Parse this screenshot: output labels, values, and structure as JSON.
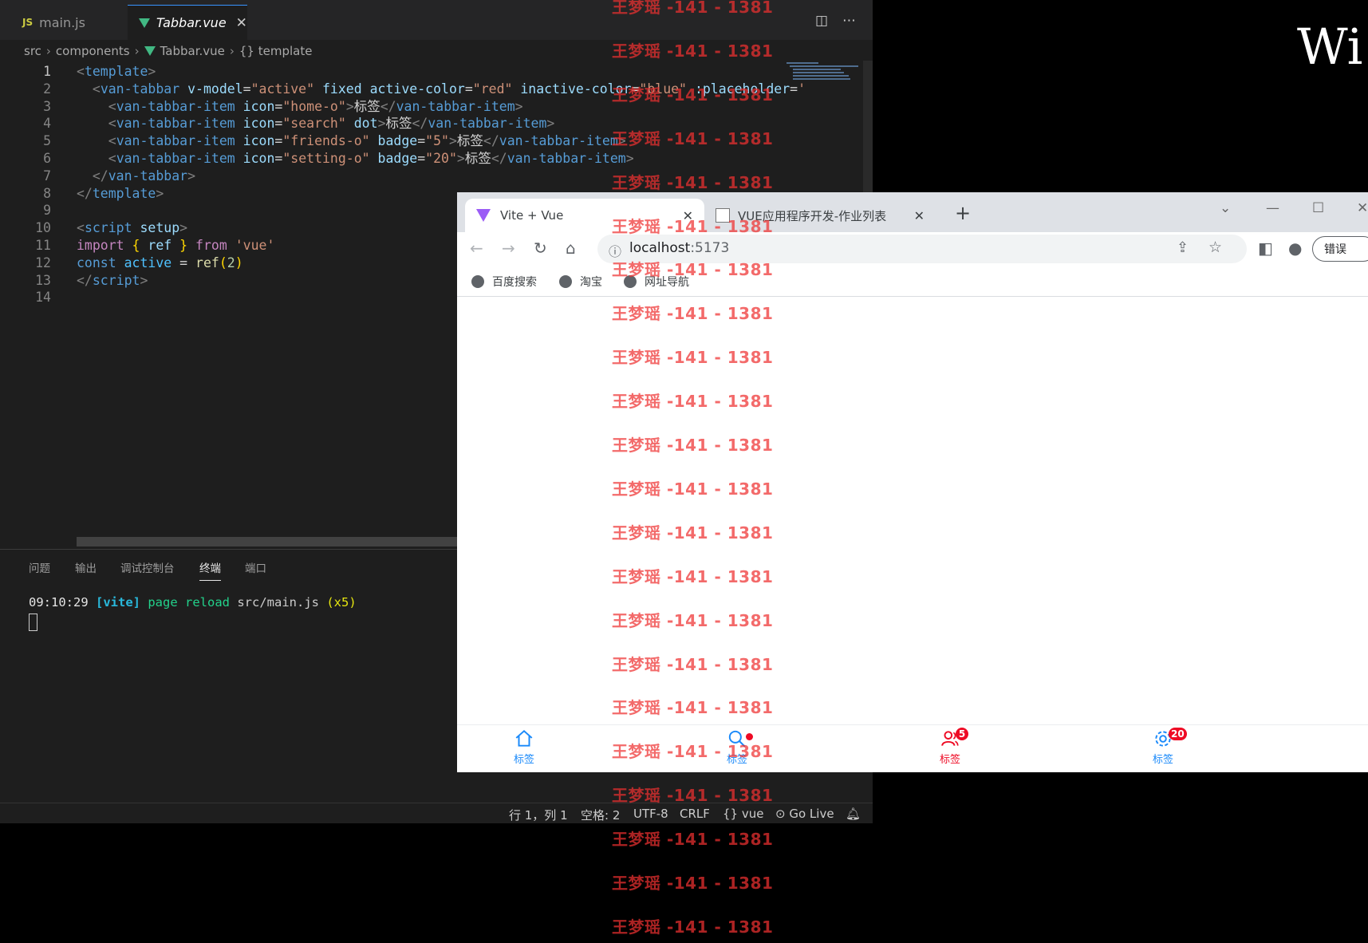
{
  "vscode": {
    "tabs": [
      {
        "badge": "JS",
        "label": "main.js"
      },
      {
        "label": "Tabbar.vue"
      }
    ],
    "breadcrumb": [
      "src",
      "components",
      "Tabbar.vue",
      "{} template"
    ],
    "code_lines": [
      [
        {
          "c": "br",
          "t": "<"
        },
        {
          "c": "t",
          "t": "template"
        },
        {
          "c": "br",
          "t": ">"
        }
      ],
      [
        {
          "c": "w",
          "t": "  "
        },
        {
          "c": "br",
          "t": "<"
        },
        {
          "c": "t",
          "t": "van-tabbar"
        },
        {
          "c": "w",
          "t": " "
        },
        {
          "c": "a",
          "t": "v-model"
        },
        {
          "c": "w",
          "t": "="
        },
        {
          "c": "s",
          "t": "\"active\""
        },
        {
          "c": "w",
          "t": " "
        },
        {
          "c": "a",
          "t": "fixed"
        },
        {
          "c": "w",
          "t": " "
        },
        {
          "c": "a",
          "t": "active-color"
        },
        {
          "c": "w",
          "t": "="
        },
        {
          "c": "s",
          "t": "\"red\""
        },
        {
          "c": "w",
          "t": " "
        },
        {
          "c": "a",
          "t": "inactive-color"
        },
        {
          "c": "w",
          "t": "="
        },
        {
          "c": "s",
          "t": "\"blue\""
        },
        {
          "c": "w",
          "t": " "
        },
        {
          "c": "a",
          "t": ":placeholder"
        },
        {
          "c": "w",
          "t": "="
        },
        {
          "c": "s",
          "t": "'"
        }
      ],
      [
        {
          "c": "w",
          "t": "    "
        },
        {
          "c": "br",
          "t": "<"
        },
        {
          "c": "t",
          "t": "van-tabbar-item"
        },
        {
          "c": "w",
          "t": " "
        },
        {
          "c": "a",
          "t": "icon"
        },
        {
          "c": "w",
          "t": "="
        },
        {
          "c": "s",
          "t": "\"home-o\""
        },
        {
          "c": "br",
          "t": ">"
        },
        {
          "c": "w",
          "t": "标签"
        },
        {
          "c": "br",
          "t": "</"
        },
        {
          "c": "t",
          "t": "van-tabbar-item"
        },
        {
          "c": "br",
          "t": ">"
        }
      ],
      [
        {
          "c": "w",
          "t": "    "
        },
        {
          "c": "br",
          "t": "<"
        },
        {
          "c": "t",
          "t": "van-tabbar-item"
        },
        {
          "c": "w",
          "t": " "
        },
        {
          "c": "a",
          "t": "icon"
        },
        {
          "c": "w",
          "t": "="
        },
        {
          "c": "s",
          "t": "\"search\""
        },
        {
          "c": "w",
          "t": " "
        },
        {
          "c": "a",
          "t": "dot"
        },
        {
          "c": "br",
          "t": ">"
        },
        {
          "c": "w",
          "t": "标签"
        },
        {
          "c": "br",
          "t": "</"
        },
        {
          "c": "t",
          "t": "van-tabbar-item"
        },
        {
          "c": "br",
          "t": ">"
        }
      ],
      [
        {
          "c": "w",
          "t": "    "
        },
        {
          "c": "br",
          "t": "<"
        },
        {
          "c": "t",
          "t": "van-tabbar-item"
        },
        {
          "c": "w",
          "t": " "
        },
        {
          "c": "a",
          "t": "icon"
        },
        {
          "c": "w",
          "t": "="
        },
        {
          "c": "s",
          "t": "\"friends-o\""
        },
        {
          "c": "w",
          "t": " "
        },
        {
          "c": "a",
          "t": "badge"
        },
        {
          "c": "w",
          "t": "="
        },
        {
          "c": "s",
          "t": "\"5\""
        },
        {
          "c": "br",
          "t": ">"
        },
        {
          "c": "w",
          "t": "标签"
        },
        {
          "c": "br",
          "t": "</"
        },
        {
          "c": "t",
          "t": "van-tabbar-item"
        },
        {
          "c": "br",
          "t": ">"
        }
      ],
      [
        {
          "c": "w",
          "t": "    "
        },
        {
          "c": "br",
          "t": "<"
        },
        {
          "c": "t",
          "t": "van-tabbar-item"
        },
        {
          "c": "w",
          "t": " "
        },
        {
          "c": "a",
          "t": "icon"
        },
        {
          "c": "w",
          "t": "="
        },
        {
          "c": "s",
          "t": "\"setting-o\""
        },
        {
          "c": "w",
          "t": " "
        },
        {
          "c": "a",
          "t": "badge"
        },
        {
          "c": "w",
          "t": "="
        },
        {
          "c": "s",
          "t": "\"20\""
        },
        {
          "c": "br",
          "t": ">"
        },
        {
          "c": "w",
          "t": "标签"
        },
        {
          "c": "br",
          "t": "</"
        },
        {
          "c": "t",
          "t": "van-tabbar-item"
        },
        {
          "c": "br",
          "t": ">"
        }
      ],
      [
        {
          "c": "w",
          "t": "  "
        },
        {
          "c": "br",
          "t": "</"
        },
        {
          "c": "t",
          "t": "van-tabbar"
        },
        {
          "c": "br",
          "t": ">"
        }
      ],
      [
        {
          "c": "br",
          "t": "</"
        },
        {
          "c": "t",
          "t": "template"
        },
        {
          "c": "br",
          "t": ">"
        }
      ],
      [],
      [
        {
          "c": "br",
          "t": "<"
        },
        {
          "c": "t",
          "t": "script"
        },
        {
          "c": "w",
          "t": " "
        },
        {
          "c": "a",
          "t": "setup"
        },
        {
          "c": "br",
          "t": ">"
        }
      ],
      [
        {
          "c": "k",
          "t": "import"
        },
        {
          "c": "w",
          "t": " "
        },
        {
          "c": "y",
          "t": "{"
        },
        {
          "c": "w",
          "t": " "
        },
        {
          "c": "a",
          "t": "ref"
        },
        {
          "c": "w",
          "t": " "
        },
        {
          "c": "y",
          "t": "}"
        },
        {
          "c": "w",
          "t": " "
        },
        {
          "c": "k",
          "t": "from"
        },
        {
          "c": "w",
          "t": " "
        },
        {
          "c": "s",
          "t": "'vue'"
        }
      ],
      [
        {
          "c": "k2",
          "t": "const"
        },
        {
          "c": "w",
          "t": " "
        },
        {
          "c": "v",
          "t": "active"
        },
        {
          "c": "w",
          "t": " = "
        },
        {
          "c": "f",
          "t": "ref"
        },
        {
          "c": "y",
          "t": "("
        },
        {
          "c": "n",
          "t": "2"
        },
        {
          "c": "y",
          "t": ")"
        }
      ],
      [
        {
          "c": "br",
          "t": "</"
        },
        {
          "c": "t",
          "t": "script"
        },
        {
          "c": "br",
          "t": ">"
        }
      ],
      []
    ],
    "panel_tabs": [
      "问题",
      "输出",
      "调试控制台",
      "终端",
      "端口"
    ],
    "active_panel_tab": "终端",
    "terminal": {
      "time": "09:10:29",
      "tag": "[vite]",
      "msg": "page reload",
      "file": "src/main.js",
      "count": "(x5)"
    },
    "status": {
      "position": "行 1，列 1",
      "spaces": "空格: 2",
      "encoding": "UTF-8",
      "eol": "CRLF",
      "lang": "{} vue",
      "golive": "Go Live"
    }
  },
  "browser": {
    "tabs": [
      {
        "title": "Vite + Vue",
        "active": true
      },
      {
        "title": "VUE应用程序开发-作业列表",
        "active": false
      }
    ],
    "url_host": "localhost",
    "url_port": ":5173",
    "bookmarks": [
      "百度搜索",
      "淘宝",
      "网址导航"
    ],
    "error_button": "错误",
    "tabbar": {
      "active_color": "#ee0a24",
      "inactive_color": "#1989fa",
      "active_index": 2,
      "items": [
        {
          "icon": "home-o",
          "label": "标签",
          "badge": null,
          "dot": false
        },
        {
          "icon": "search",
          "label": "标签",
          "badge": null,
          "dot": true
        },
        {
          "icon": "friends-o",
          "label": "标签",
          "badge": "5",
          "dot": false
        },
        {
          "icon": "setting-o",
          "label": "标签",
          "badge": "20",
          "dot": false
        }
      ]
    }
  },
  "watermark": "王梦瑶 -141 - 1381",
  "overlay_text": "Wi"
}
